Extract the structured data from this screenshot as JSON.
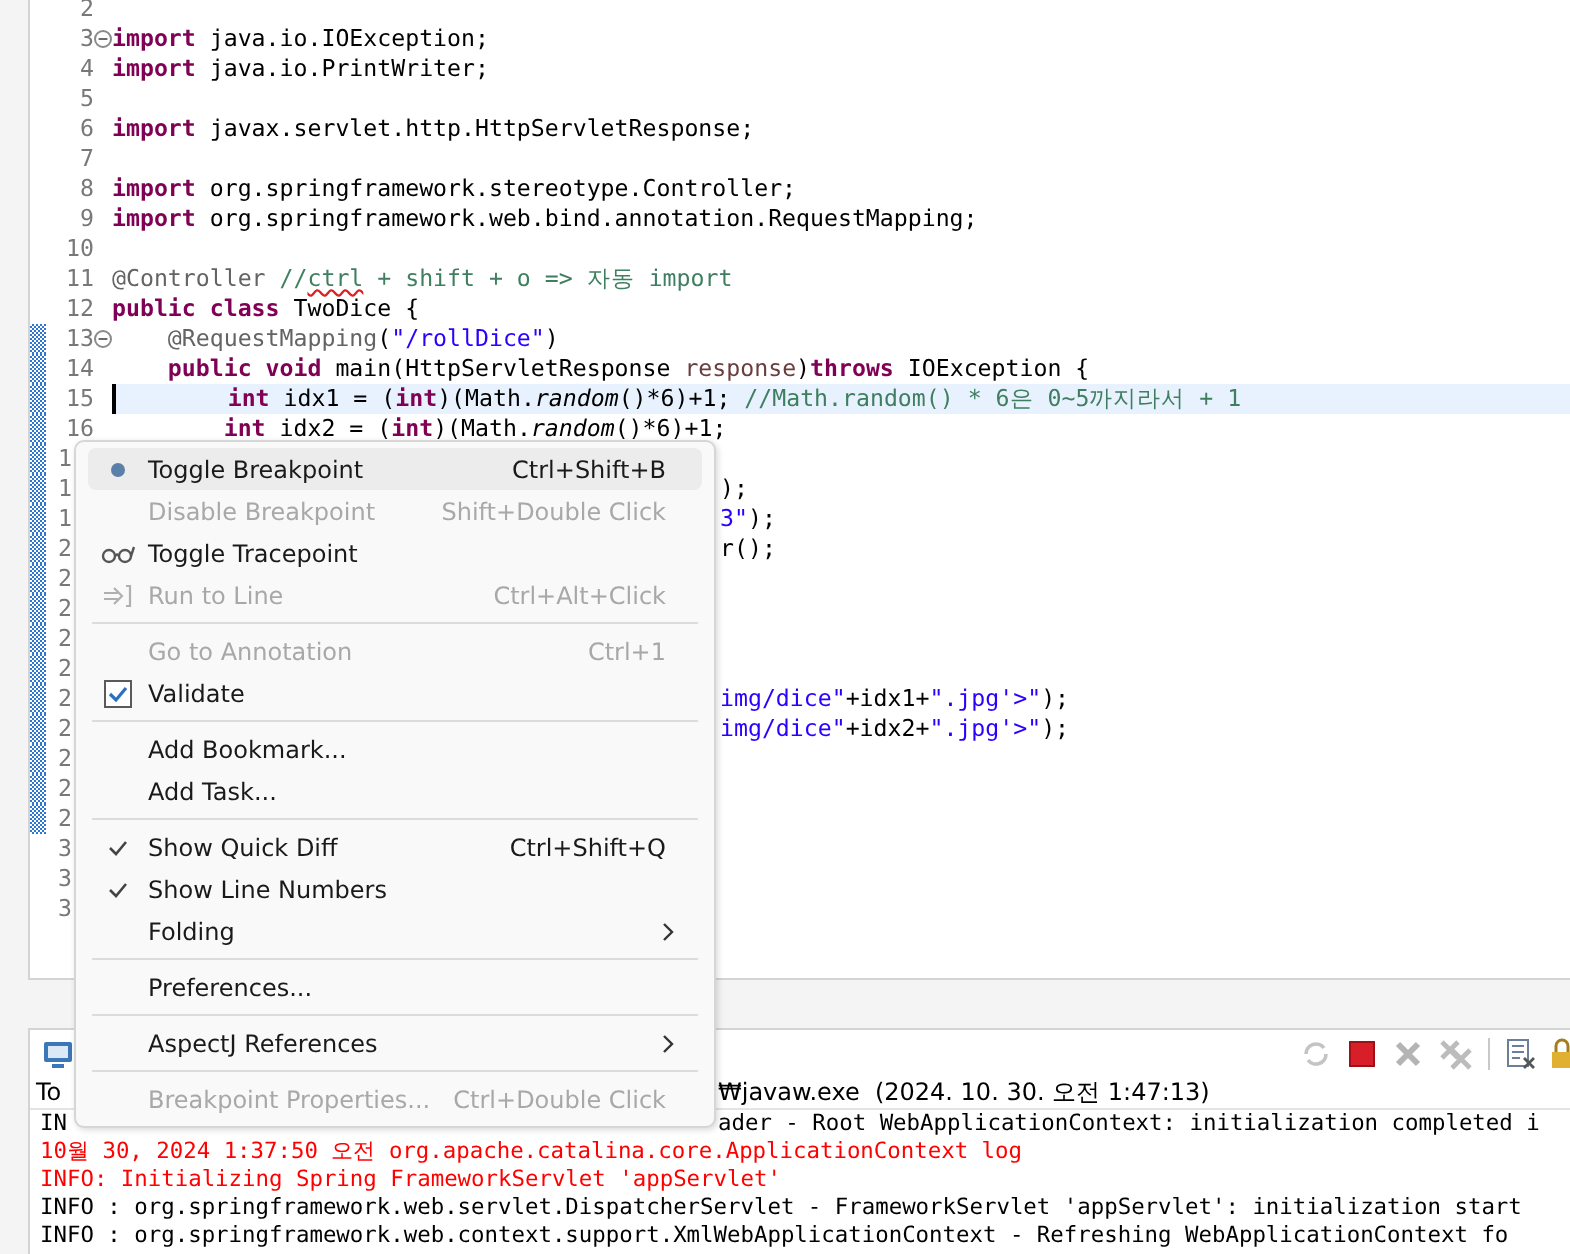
{
  "editor": {
    "lines": [
      {
        "number": "2",
        "kind": "full",
        "changed": false,
        "fold": false,
        "current": false
      },
      {
        "number": "3",
        "kind": "full",
        "changed": false,
        "fold": true,
        "current": false,
        "tokens": [
          {
            "text": "import",
            "kind": "keyword"
          },
          {
            "text": " java.io.IOException;",
            "kind": "plain"
          }
        ]
      },
      {
        "number": "4",
        "kind": "full",
        "changed": false,
        "fold": false,
        "current": false,
        "tokens": [
          {
            "text": "import",
            "kind": "keyword"
          },
          {
            "text": " java.io.PrintWriter;",
            "kind": "plain"
          }
        ]
      },
      {
        "number": "5",
        "kind": "full",
        "changed": false,
        "fold": false,
        "current": false
      },
      {
        "number": "6",
        "kind": "full",
        "changed": false,
        "fold": false,
        "current": false,
        "tokens": [
          {
            "text": "import",
            "kind": "keyword"
          },
          {
            "text": " javax.servlet.http.HttpServletResponse;",
            "kind": "plain"
          }
        ]
      },
      {
        "number": "7",
        "kind": "full",
        "changed": false,
        "fold": false,
        "current": false
      },
      {
        "number": "8",
        "kind": "full",
        "changed": false,
        "fold": false,
        "current": false,
        "tokens": [
          {
            "text": "import",
            "kind": "keyword"
          },
          {
            "text": " org.springframework.stereotype.Controller;",
            "kind": "plain"
          }
        ]
      },
      {
        "number": "9",
        "kind": "full",
        "changed": false,
        "fold": false,
        "current": false,
        "tokens": [
          {
            "text": "import",
            "kind": "keyword"
          },
          {
            "text": " org.springframework.web.bind.annotation.RequestMapping;",
            "kind": "plain"
          }
        ]
      },
      {
        "number": "10",
        "kind": "full",
        "changed": false,
        "fold": false,
        "current": false
      },
      {
        "number": "11",
        "kind": "full",
        "changed": false,
        "fold": false,
        "current": false,
        "tokens": [
          {
            "text": "@Controller",
            "kind": "annotation"
          },
          {
            "text": " //",
            "kind": "comment"
          },
          {
            "text": "ctrl",
            "kind": "misspelled"
          },
          {
            "text": " + shift + o => 자동 import",
            "kind": "comment"
          }
        ]
      },
      {
        "number": "12",
        "kind": "full",
        "changed": false,
        "fold": false,
        "current": false,
        "tokens": [
          {
            "text": "public",
            "kind": "keyword"
          },
          {
            "text": " class",
            "kind": "keyword"
          },
          {
            "text": " TwoDice {",
            "kind": "plain"
          }
        ]
      },
      {
        "number": "13",
        "kind": "full",
        "changed": true,
        "fold": true,
        "current": false,
        "tokens": [
          {
            "text": "    @RequestMapping",
            "kind": "annotation"
          },
          {
            "text": "(",
            "kind": "plain"
          },
          {
            "text": "\"/rollDice\"",
            "kind": "string"
          },
          {
            "text": ")",
            "kind": "plain"
          }
        ]
      },
      {
        "number": "14",
        "kind": "full",
        "changed": true,
        "fold": false,
        "current": false,
        "tokens": [
          {
            "text": "    public",
            "kind": "keyword"
          },
          {
            "text": " void",
            "kind": "keyword"
          },
          {
            "text": " main(HttpServletResponse ",
            "kind": "plain"
          },
          {
            "text": "response",
            "kind": "param"
          },
          {
            "text": ")",
            "kind": "plain"
          },
          {
            "text": "throws",
            "kind": "keyword"
          },
          {
            "text": " IOException {",
            "kind": "plain"
          }
        ]
      },
      {
        "number": "15",
        "kind": "full",
        "changed": true,
        "fold": false,
        "current": true,
        "tokens": [
          {
            "text": "        int",
            "kind": "keyword"
          },
          {
            "text": " idx1 = (",
            "kind": "plain"
          },
          {
            "text": "int",
            "kind": "keyword"
          },
          {
            "text": ")(Math.",
            "kind": "plain"
          },
          {
            "text": "random",
            "kind": "italic"
          },
          {
            "text": "()*6)+1; ",
            "kind": "plain"
          },
          {
            "text": "//Math.random() * 6은 0~5까지라서 + 1",
            "kind": "comment"
          }
        ]
      },
      {
        "number": "16",
        "kind": "full",
        "changed": true,
        "fold": false,
        "current": false,
        "tokens": [
          {
            "text": "        int",
            "kind": "keyword"
          },
          {
            "text": " idx2 = (",
            "kind": "plain"
          },
          {
            "text": "int",
            "kind": "keyword"
          },
          {
            "text": ")(Math.",
            "kind": "plain"
          },
          {
            "text": "random",
            "kind": "italic"
          },
          {
            "text": "()*6)+1;",
            "kind": "plain"
          }
        ]
      },
      {
        "number": "1",
        "kind": "partial",
        "changed": true,
        "fold": false,
        "current": false
      },
      {
        "number": "1",
        "kind": "partial",
        "changed": true,
        "fold": false,
        "current": false,
        "tokens": [
          {
            "text": ");",
            "kind": "plain"
          }
        ]
      },
      {
        "number": "1",
        "kind": "partial",
        "changed": true,
        "fold": false,
        "current": false,
        "tokens": [
          {
            "text": "3\"",
            "kind": "string"
          },
          {
            "text": ");",
            "kind": "plain"
          }
        ]
      },
      {
        "number": "2",
        "kind": "partial",
        "changed": true,
        "fold": false,
        "current": false,
        "tokens": [
          {
            "text": "r();",
            "kind": "plain"
          }
        ]
      },
      {
        "number": "2",
        "kind": "partial",
        "changed": true,
        "fold": false,
        "current": false
      },
      {
        "number": "2",
        "kind": "partial",
        "changed": true,
        "fold": false,
        "current": false
      },
      {
        "number": "2",
        "kind": "partial",
        "changed": true,
        "fold": false,
        "current": false
      },
      {
        "number": "2",
        "kind": "partial",
        "changed": true,
        "fold": false,
        "current": false
      },
      {
        "number": "2",
        "kind": "partial",
        "changed": true,
        "fold": false,
        "current": false,
        "tokens": [
          {
            "text": "img/dice\"",
            "kind": "string"
          },
          {
            "text": "+idx1+",
            "kind": "plain"
          },
          {
            "text": "\".jpg'>\"",
            "kind": "string"
          },
          {
            "text": ");",
            "kind": "plain"
          }
        ]
      },
      {
        "number": "2",
        "kind": "partial",
        "changed": true,
        "fold": false,
        "current": false,
        "tokens": [
          {
            "text": "img/dice\"",
            "kind": "string"
          },
          {
            "text": "+idx2+",
            "kind": "plain"
          },
          {
            "text": "\".jpg'>\"",
            "kind": "string"
          },
          {
            "text": ");",
            "kind": "plain"
          }
        ]
      },
      {
        "number": "2",
        "kind": "partial",
        "changed": true,
        "fold": false,
        "current": false
      },
      {
        "number": "2",
        "kind": "partial",
        "changed": true,
        "fold": false,
        "current": false
      },
      {
        "number": "2",
        "kind": "partial",
        "changed": true,
        "fold": false,
        "current": false
      },
      {
        "number": "3",
        "kind": "partial",
        "changed": false,
        "fold": false,
        "current": false
      },
      {
        "number": "3",
        "kind": "partial",
        "changed": false,
        "fold": false,
        "current": false
      },
      {
        "number": "3",
        "kind": "partial",
        "changed": false,
        "fold": false,
        "current": false
      }
    ]
  },
  "context_menu": {
    "groups": [
      [
        {
          "label": "Toggle Breakpoint",
          "shortcut": "Ctrl+Shift+B",
          "kind": "breakpoint",
          "disabled": false,
          "selected": true
        },
        {
          "label": "Disable Breakpoint",
          "shortcut": "Shift+Double Click",
          "kind": "action",
          "disabled": true,
          "selected": false
        },
        {
          "label": "Toggle Tracepoint",
          "kind": "tracepoint",
          "disabled": false,
          "selected": false
        },
        {
          "label": "Run to Line",
          "shortcut": "Ctrl+Alt+Click",
          "kind": "runto",
          "disabled": true,
          "selected": false
        }
      ],
      [
        {
          "label": "Go to Annotation",
          "shortcut": "Ctrl+1",
          "kind": "action",
          "disabled": true,
          "selected": false
        },
        {
          "label": "Validate",
          "kind": "checkbox",
          "checked": true,
          "disabled": false,
          "selected": false
        }
      ],
      [
        {
          "label": "Add Bookmark...",
          "kind": "action",
          "disabled": false,
          "selected": false
        },
        {
          "label": "Add Task...",
          "kind": "action",
          "disabled": false,
          "selected": false
        }
      ],
      [
        {
          "label": "Show Quick Diff",
          "shortcut": "Ctrl+Shift+Q",
          "kind": "toggle",
          "checked": true,
          "disabled": false,
          "selected": false
        },
        {
          "label": "Show Line Numbers",
          "kind": "toggle",
          "checked": true,
          "disabled": false,
          "selected": false
        },
        {
          "label": "Folding",
          "kind": "submenu",
          "disabled": false,
          "selected": false
        }
      ],
      [
        {
          "label": "Preferences...",
          "kind": "action",
          "disabled": false,
          "selected": false
        }
      ],
      [
        {
          "label": "AspectJ References",
          "kind": "submenu",
          "disabled": false,
          "selected": false
        }
      ],
      [
        {
          "label": "Breakpoint Properties...",
          "shortcut": "Ctrl+Double Click",
          "kind": "action",
          "disabled": true,
          "selected": false
        }
      ]
    ]
  },
  "console": {
    "title_left": "To",
    "title_right": "₩javaw.exe  (2024. 10. 30. 오전 1:47:13)",
    "lines": [
      {
        "left": "IN",
        "text": "ader - Root WebApplicationContext: initialization completed i",
        "color": "#000000"
      },
      {
        "text": "10월 30, 2024 1:37:50 오전 org.apache.catalina.core.ApplicationContext log",
        "color": "#ff0000"
      },
      {
        "text": "INFO: Initializing Spring FrameworkServlet 'appServlet'",
        "color": "#ff0000"
      },
      {
        "text": "INFO : org.springframework.web.servlet.DispatcherServlet - FrameworkServlet 'appServlet': initialization start",
        "color": "#000000"
      },
      {
        "text": "INFO : org.springframework.web.context.support.XmlWebApplicationContext - Refreshing WebApplicationContext fo",
        "color": "#000000"
      }
    ]
  }
}
